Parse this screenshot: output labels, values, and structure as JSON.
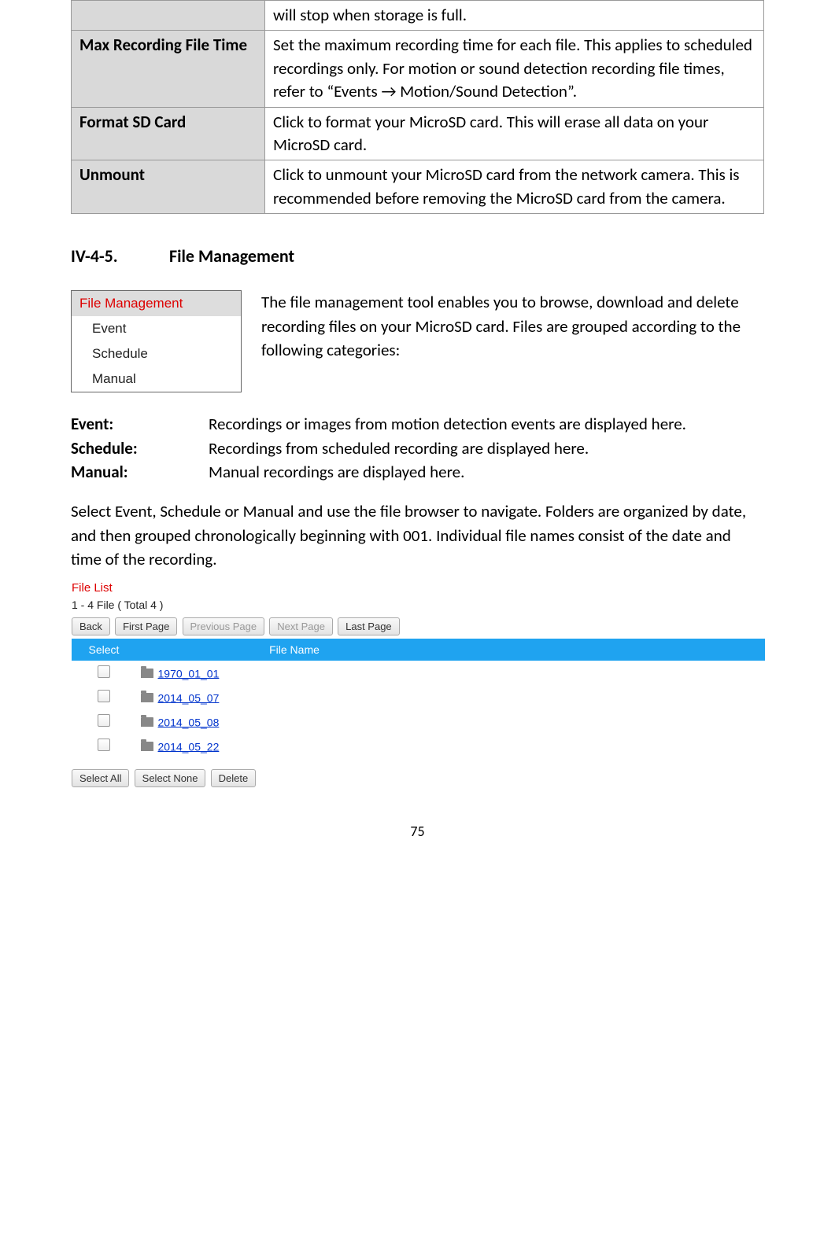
{
  "table": {
    "rows": [
      {
        "label": "",
        "desc": "will stop when storage is full."
      },
      {
        "label": "Max Recording File Time",
        "desc": "Set the maximum recording time for each file. This applies to scheduled recordings only. For motion or sound detection recording file times, refer to “Events → Motion/Sound Detection”."
      },
      {
        "label": "Format SD Card",
        "desc": "Click to format your MicroSD card. This will erase all data on your MicroSD card."
      },
      {
        "label": "Unmount",
        "desc": "Click to unmount your MicroSD card from the network camera. This is recommended before removing the MicroSD card from the camera."
      }
    ]
  },
  "section": {
    "num": "IV-4-5.",
    "title": "File Management"
  },
  "menu": {
    "items": [
      {
        "label": "File Management",
        "active": true
      },
      {
        "label": "Event"
      },
      {
        "label": "Schedule"
      },
      {
        "label": "Manual"
      }
    ]
  },
  "intro": "The file management tool enables you to browse, download and delete recording files on your MicroSD card. Files are grouped according to the following categories:",
  "defs": [
    {
      "term": "Event:",
      "desc": "Recordings or images from motion detection events are displayed here."
    },
    {
      "term": "Schedule:",
      "desc": "Recordings from scheduled recording are displayed here."
    },
    {
      "term": "Manual:",
      "desc": "Manual recordings are displayed here."
    }
  ],
  "para": "Select Event, Schedule or Manual and use the file browser to navigate. Folders are organized by date, and then grouped chronologically beginning with 001. Individual file names consist of the date and time of the recording.",
  "filelist": {
    "title": "File List",
    "count": "1 - 4 File ( Total 4 )",
    "nav": {
      "back": "Back",
      "first": "First Page",
      "prev": "Previous Page",
      "next": "Next Page",
      "last": "Last Page"
    },
    "headers": {
      "select": "Select",
      "filename": "File Name",
      "third": ""
    },
    "rows": [
      {
        "name": "1970_01_01"
      },
      {
        "name": "2014_05_07"
      },
      {
        "name": "2014_05_08"
      },
      {
        "name": "2014_05_22"
      }
    ],
    "actions": {
      "selall": "Select All",
      "selnone": "Select None",
      "delete": "Delete"
    }
  },
  "pagenum": "75"
}
